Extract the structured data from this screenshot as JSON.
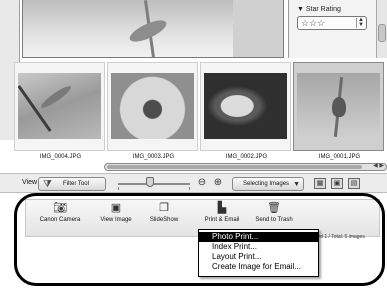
{
  "filter_panel": {
    "star_rating_label": "▼ Star Rating",
    "star_rating_value": "☆☆☆"
  },
  "thumbnails": [
    {
      "filename": "IMG_0004.JPG",
      "selected": false
    },
    {
      "filename": "IMG_0003.JPG",
      "selected": false
    },
    {
      "filename": "IMG_0002.JPG",
      "selected": false
    },
    {
      "filename": "IMG_0001.JPG",
      "selected": true
    }
  ],
  "toolbar": {
    "view_label": "View",
    "filter_tool": "Filter Tool",
    "selecting_images": "Selecting Images"
  },
  "tasks": [
    {
      "label": "Canon Camera",
      "icon": "camera-icon"
    },
    {
      "label": "View Image",
      "icon": "view-image-icon"
    },
    {
      "label": "SlideShow",
      "icon": "slideshow-icon"
    },
    {
      "label": "Print & Email",
      "icon": "printer-icon"
    },
    {
      "label": "Send to Trash",
      "icon": "trash-icon"
    }
  ],
  "status": {
    "selection": "ted 1 / Total: 5 images"
  },
  "context_menu": {
    "items": [
      {
        "label": "Photo Print...",
        "highlighted": true
      },
      {
        "label": "Index Print...",
        "highlighted": false
      },
      {
        "label": "Layout Print...",
        "highlighted": false
      },
      {
        "label": "Create Image for Email...",
        "highlighted": false
      }
    ]
  }
}
